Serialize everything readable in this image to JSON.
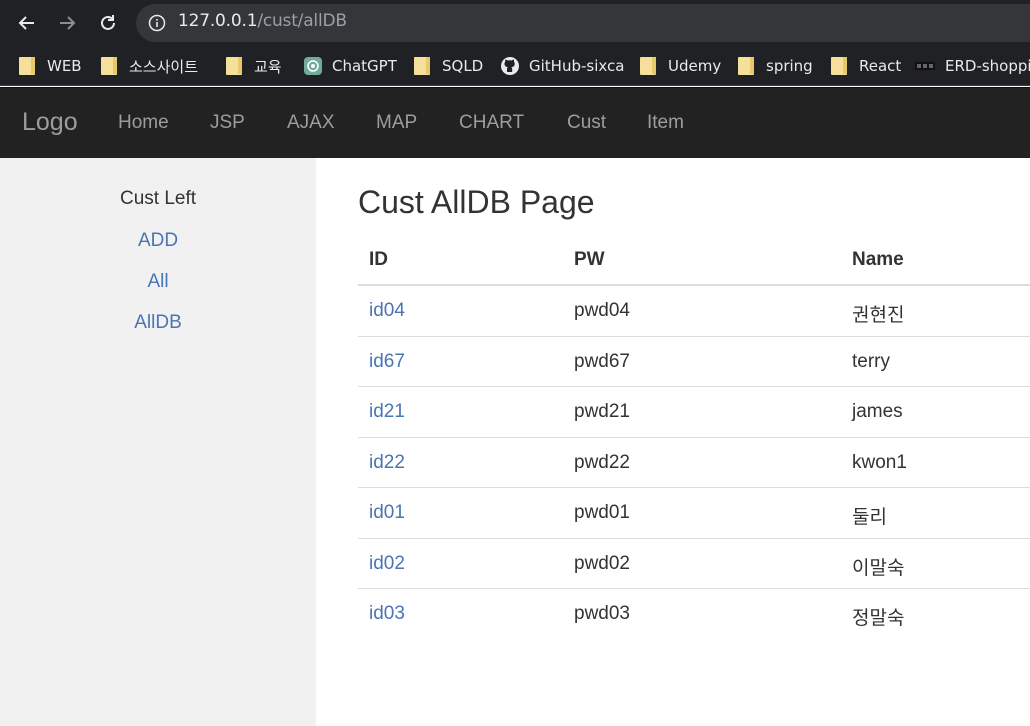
{
  "browser": {
    "url_host": "127.0.0.1",
    "url_path": "/cust/allDB",
    "icons": [
      "back-arrow-icon",
      "forward-arrow-icon",
      "reload-icon",
      "info-icon"
    ]
  },
  "bookmarks": [
    {
      "label": "WEB",
      "icon": "folder-icon"
    },
    {
      "label": "소스사이트",
      "icon": "folder-icon"
    },
    {
      "label": "교육",
      "icon": "folder-icon"
    },
    {
      "label": "ChatGPT",
      "icon": "chatgpt-icon"
    },
    {
      "label": "SQLD",
      "icon": "folder-icon"
    },
    {
      "label": "GitHub-sixca",
      "icon": "github-icon"
    },
    {
      "label": "Udemy",
      "icon": "folder-icon"
    },
    {
      "label": "spring",
      "icon": "folder-icon"
    },
    {
      "label": "React",
      "icon": "folder-icon"
    },
    {
      "label": "ERD-shoppin",
      "icon": "erd-icon"
    }
  ],
  "navbar": {
    "brand": "Logo",
    "links": [
      "Home",
      "JSP",
      "AJAX",
      "MAP",
      "CHART",
      "Cust",
      "Item"
    ]
  },
  "sidebar": {
    "title": "Cust Left",
    "links": [
      "ADD",
      "All",
      "AllDB"
    ]
  },
  "main": {
    "title": "Cust AllDB Page",
    "columns": [
      "ID",
      "PW",
      "Name"
    ],
    "rows": [
      {
        "id": "id04",
        "pw": "pwd04",
        "name": "권현진"
      },
      {
        "id": "id67",
        "pw": "pwd67",
        "name": "terry"
      },
      {
        "id": "id21",
        "pw": "pwd21",
        "name": "james"
      },
      {
        "id": "id22",
        "pw": "pwd22",
        "name": "kwon1"
      },
      {
        "id": "id01",
        "pw": "pwd01",
        "name": "둘리"
      },
      {
        "id": "id02",
        "pw": "pwd02",
        "name": "이말숙"
      },
      {
        "id": "id03",
        "pw": "pwd03",
        "name": "정말숙"
      }
    ]
  },
  "colors": {
    "chrome": "#202124",
    "navbar": "#222222",
    "sidebar": "#f1f1f1",
    "link": "#4a74b3"
  }
}
